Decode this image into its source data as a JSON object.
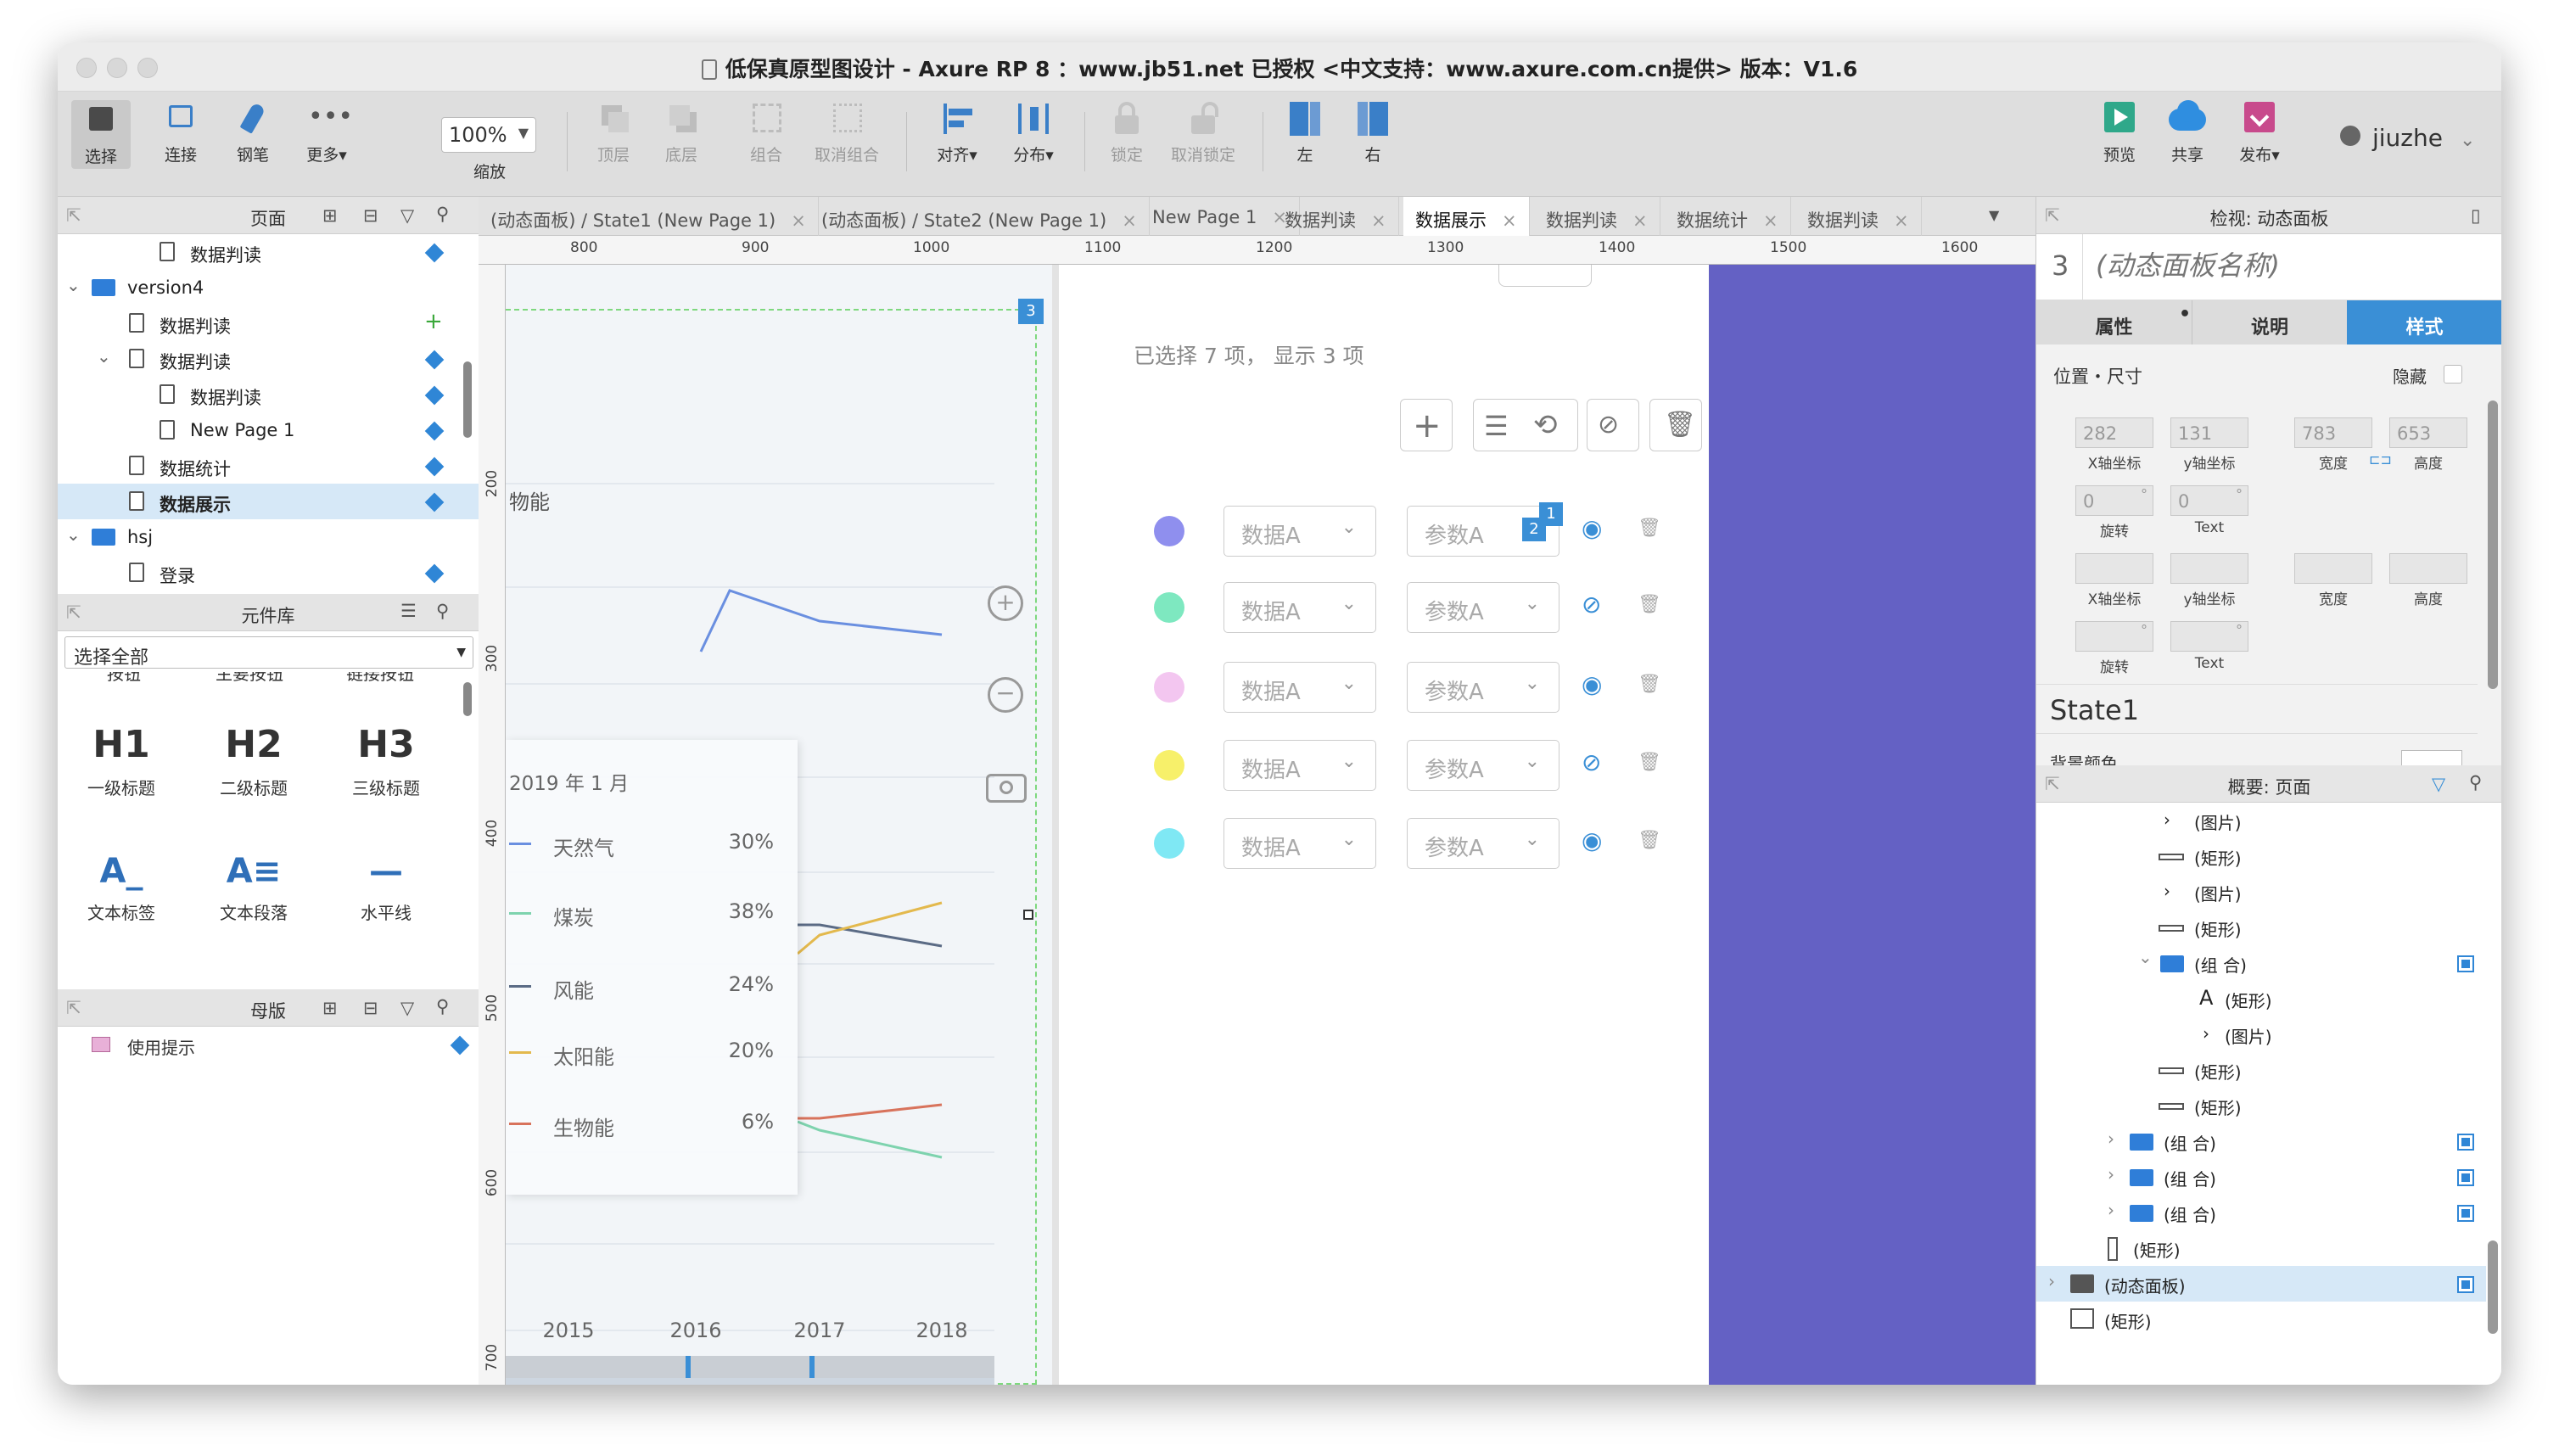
{
  "window": {
    "title": "低保真原型图设计 - Axure RP 8 ：www.jb51.net 已授权  <中文支持：www.axure.com.cn提供> 版本：V1.6"
  },
  "toolbar": {
    "select": "选择",
    "connect": "连接",
    "pen": "钢笔",
    "more": "更多▾",
    "zoom": "100%",
    "zoom_label": "缩放",
    "top": "顶层",
    "bottom": "底层",
    "group": "组合",
    "ungroup": "取消组合",
    "align": "对齐▾",
    "distribute": "分布▾",
    "lock": "锁定",
    "unlock": "取消锁定",
    "left": "左",
    "right": "右",
    "preview": "预览",
    "share": "共享",
    "publish": "发布▾",
    "user": "jiuzhe"
  },
  "pages_panel": {
    "title": "页面",
    "items": [
      "数据判读",
      "version4",
      "数据判读",
      "数据判读",
      "数据判读",
      "New Page 1",
      "数据统计",
      "数据展示",
      "hsj",
      "登录"
    ]
  },
  "library_panel": {
    "title": "元件库",
    "select": "选择全部",
    "partial_labels": [
      "按钮",
      "主要按钮",
      "链接按钮"
    ],
    "widgets": [
      {
        "glyph": "H1",
        "label": "一级标题"
      },
      {
        "glyph": "H2",
        "label": "二级标题"
      },
      {
        "glyph": "H3",
        "label": "三级标题"
      },
      {
        "glyph": "A_",
        "label": "文本标签"
      },
      {
        "glyph": "A≡",
        "label": "文本段落"
      },
      {
        "glyph": "—",
        "label": "水平线"
      }
    ]
  },
  "masters_panel": {
    "title": "母版",
    "items": [
      "使用提示"
    ]
  },
  "tabs": [
    "(动态面板) / State1 (New Page 1)",
    "(动态面板) / State2 (New Page 1)",
    "New Page 1",
    "数据判读",
    "数据展示",
    "数据判读",
    "数据统计",
    "数据判读"
  ],
  "ruler": {
    "top": [
      "800",
      "900",
      "1000",
      "1100",
      "1200",
      "1300",
      "1400",
      "1500",
      "1600"
    ],
    "left": [
      "200",
      "300",
      "400",
      "500",
      "600",
      "700"
    ]
  },
  "canvas": {
    "badge_panel": "3",
    "badge_a": "2",
    "badge_b": "1",
    "chart_partial_label": "物能",
    "tooltip_title": "2019 年 1 月",
    "selection_text": "已选择 7 项， 显示 3 项",
    "select_placeholder": "数据A",
    "param_placeholder": "参数A",
    "dot_colors": [
      "#8f8fee",
      "#7ee8c0",
      "#f3c6f0",
      "#f7f06a",
      "#7fe8f4"
    ],
    "panel_color": "#6461c4"
  },
  "chart_data": {
    "type": "line",
    "x": [
      "2015",
      "2016",
      "2017",
      "2018"
    ],
    "title": "2019 年 1 月",
    "series": [
      {
        "name": "天然气",
        "value": "30%",
        "color": "#6a8fe0"
      },
      {
        "name": "煤炭",
        "value": "38%",
        "color": "#7ed3ae"
      },
      {
        "name": "风能",
        "value": "24%",
        "color": "#5b6b85"
      },
      {
        "name": "太阳能",
        "value": "20%",
        "color": "#e3b94d"
      },
      {
        "name": "生物能",
        "value": "6%",
        "color": "#d8735c"
      }
    ]
  },
  "inspector": {
    "header": "检视: 动态面板",
    "index": "3",
    "name_placeholder": "(动态面板名称)",
    "tabs": [
      "属性",
      "说明",
      "样式"
    ],
    "section": "位置・尺寸",
    "hide": "隐藏",
    "x": "282",
    "y": "131",
    "w": "783",
    "h": "653",
    "x_lbl": "X轴坐标",
    "y_lbl": "y轴坐标",
    "w_lbl": "宽度",
    "h_lbl": "高度",
    "rot": "0",
    "text": "0",
    "rot_lbl": "旋转",
    "text_lbl": "Text",
    "state": "State1",
    "bg": "背景颜色"
  },
  "outline": {
    "title": "概要: 页面",
    "items": [
      "(图片)",
      "(矩形)",
      "(图片)",
      "(矩形)",
      "(组 合)",
      "(矩形)",
      "(图片)",
      "(矩形)",
      "(矩形)",
      "(组 合)",
      "(组 合)",
      "(组 合)",
      "(矩形)",
      "(动态面板)",
      "(矩形)"
    ]
  }
}
